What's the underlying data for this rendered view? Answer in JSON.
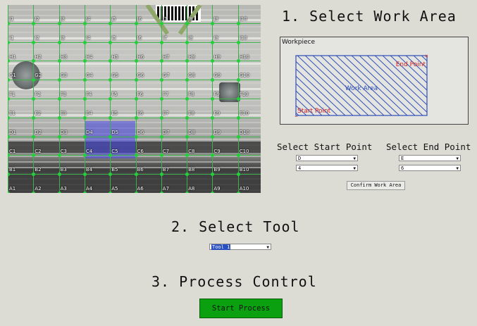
{
  "camera": {
    "rows": [
      "J",
      "I",
      "H",
      "G",
      "F",
      "E",
      "D",
      "C",
      "B",
      "A"
    ],
    "columns": [
      "1",
      "2",
      "3",
      "4",
      "5",
      "6",
      "7",
      "8",
      "9",
      "10"
    ],
    "selected_cells": [
      "D4",
      "D5",
      "E4",
      "E5"
    ]
  },
  "section1": {
    "title": "1. Select Work Area",
    "workpiece_label": "Workpiece",
    "work_area_label": "Work Area",
    "start_point_label": "Start Point",
    "end_point_label": "End Point",
    "start_heading": "Select Start Point",
    "end_heading": "Select End Point",
    "start_row": "D",
    "start_col": "4",
    "end_row": "E",
    "end_col": "6",
    "confirm_button": "Confirm Work Area"
  },
  "section2": {
    "title": "2. Select Tool",
    "tool_value": "Tool 1"
  },
  "section3": {
    "title": "3. Process Control",
    "start_button": "Start Process"
  },
  "colors": {
    "grid": "#3cb34a",
    "selection": "#4646e6",
    "work_area": "#2f4fb8",
    "point_labels": "#cc2222",
    "start_button": "#0aa00f"
  }
}
